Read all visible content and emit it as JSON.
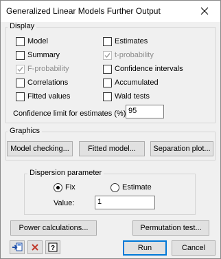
{
  "window": {
    "title": "Generalized Linear Models Further Output"
  },
  "display": {
    "label": "Display",
    "options": [
      {
        "key": "model",
        "label": "Model",
        "checked": false,
        "enabled": true
      },
      {
        "key": "estimates",
        "label": "Estimates",
        "checked": false,
        "enabled": true
      },
      {
        "key": "summary",
        "label": "Summary",
        "checked": false,
        "enabled": true
      },
      {
        "key": "t_probability",
        "label": "t-probability",
        "checked": true,
        "enabled": false
      },
      {
        "key": "f_probability",
        "label": "F-probability",
        "checked": true,
        "enabled": false
      },
      {
        "key": "confidence_intervals",
        "label": "Confidence intervals",
        "checked": false,
        "enabled": true
      },
      {
        "key": "correlations",
        "label": "Correlations",
        "checked": false,
        "enabled": true
      },
      {
        "key": "accumulated",
        "label": "Accumulated",
        "checked": false,
        "enabled": true
      },
      {
        "key": "fitted_values",
        "label": "Fitted values",
        "checked": false,
        "enabled": true
      },
      {
        "key": "wald_tests",
        "label": "Wald tests",
        "checked": false,
        "enabled": true
      }
    ],
    "confidence_limit_label": "Confidence limit for estimates (%):",
    "confidence_limit_value": "95"
  },
  "graphics": {
    "label": "Graphics",
    "model_checking": "Model checking...",
    "fitted_model": "Fitted model...",
    "separation_plot": "Separation plot..."
  },
  "dispersion": {
    "label": "Dispersion parameter",
    "fix_label": "Fix",
    "estimate_label": "Estimate",
    "selected": "fix",
    "value_label": "Value:",
    "value": "1"
  },
  "buttons": {
    "power_calculations": "Power calculations...",
    "permutation_test": "Permutation test...",
    "run": "Run",
    "cancel": "Cancel"
  },
  "icons": {
    "close": "close-icon",
    "transfer": "transfer-icon",
    "clear": "clear-icon",
    "help": "help-icon"
  }
}
